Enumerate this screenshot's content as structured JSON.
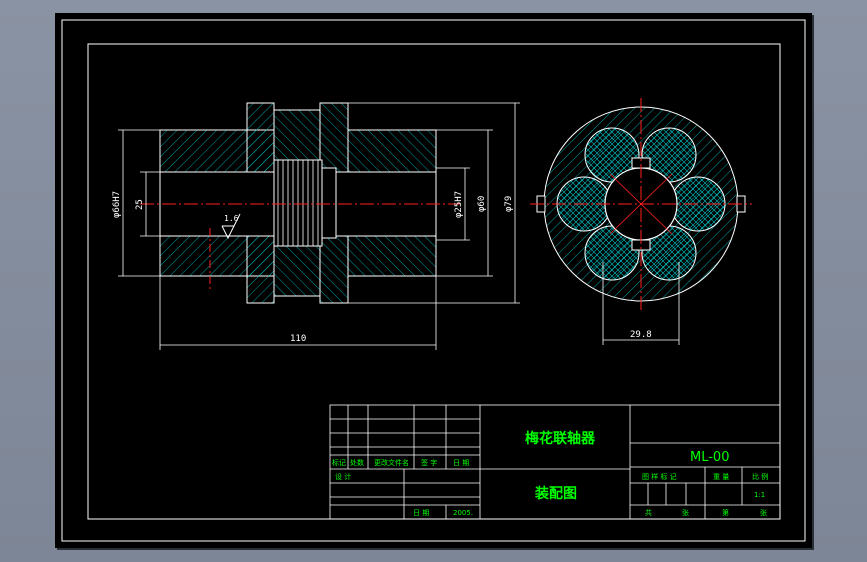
{
  "drawing": {
    "dimensions": {
      "left_outer_dia": "φ66H7",
      "left_inner": "25",
      "bore_dia": "φ25H7",
      "hub_dia": "φ60",
      "outer_dia": "φ79",
      "length": "110",
      "roughness": "1.6",
      "element_width": "29.8"
    }
  },
  "title_block": {
    "product_name": "梅花联轴器",
    "drawing_type": "装配图",
    "drawing_number": "ML-00",
    "scale_value": "1:1",
    "date_value": "2005.",
    "labels": {
      "mark": "标记",
      "count": "处数",
      "change_doc": "更改文件名",
      "sign": "签 字",
      "date": "日 期",
      "design": "设 计",
      "stage_mark": "图 样 标 记",
      "weight": "重 量",
      "scale": "比 例",
      "date_bottom": "日 期",
      "total": "共",
      "sheet": "张",
      "sheet_no": "第",
      "sheet_of": "张"
    }
  },
  "colors": {
    "outline": "#ffffff",
    "hatch": "#00c8c8",
    "centerline": "#ff2020",
    "text": "#00ff00"
  }
}
